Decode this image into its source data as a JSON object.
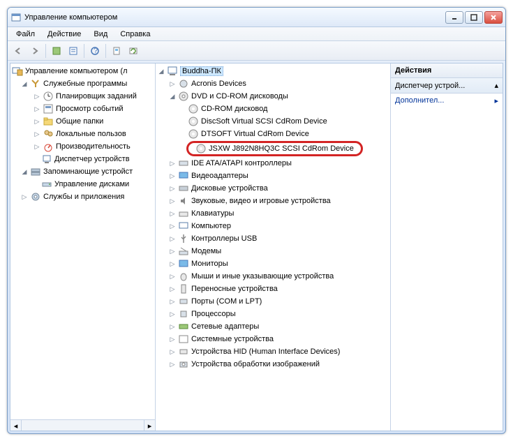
{
  "window": {
    "title": "Управление компьютером"
  },
  "menu": {
    "file": "Файл",
    "action": "Действие",
    "view": "Вид",
    "help": "Справка"
  },
  "leftTree": {
    "root": "Управление компьютером (л",
    "sysTools": "Служебные программы",
    "scheduler": "Планировщик заданий",
    "eventViewer": "Просмотр событий",
    "sharedFolders": "Общие папки",
    "localUsers": "Локальные пользов",
    "performance": "Производительность",
    "deviceManager": "Диспетчер устройств",
    "storage": "Запоминающие устройст",
    "diskMgmt": "Управление дисками",
    "services": "Службы и приложения"
  },
  "midTree": {
    "root": "Buddha-ПК",
    "acronis": "Acronis Devices",
    "dvd": "DVD и CD-ROM дисководы",
    "cdrom": "CD-ROM дисковод",
    "discsoft": "DiscSoft Virtual SCSI CdRom Device",
    "dtsoft": "DTSOFT Virtual CdRom Device",
    "jsxw": "JSXW J892N8HQ3C SCSI CdRom Device",
    "ide": "IDE ATA/ATAPI контроллеры",
    "video": "Видеоадаптеры",
    "disk": "Дисковые устройства",
    "audio": "Звуковые, видео и игровые устройства",
    "keyboard": "Клавиатуры",
    "computer": "Компьютер",
    "usb": "Контроллеры USB",
    "modems": "Модемы",
    "monitors": "Мониторы",
    "mice": "Мыши и иные указывающие устройства",
    "portable": "Переносные устройства",
    "ports": "Порты (COM и LPT)",
    "cpu": "Процессоры",
    "network": "Сетевые адаптеры",
    "system": "Системные устройства",
    "hid": "Устройства HID (Human Interface Devices)",
    "imaging": "Устройства обработки изображений"
  },
  "right": {
    "header": "Действия",
    "devmgr": "Диспетчер устрой...",
    "more": "Дополнител..."
  }
}
